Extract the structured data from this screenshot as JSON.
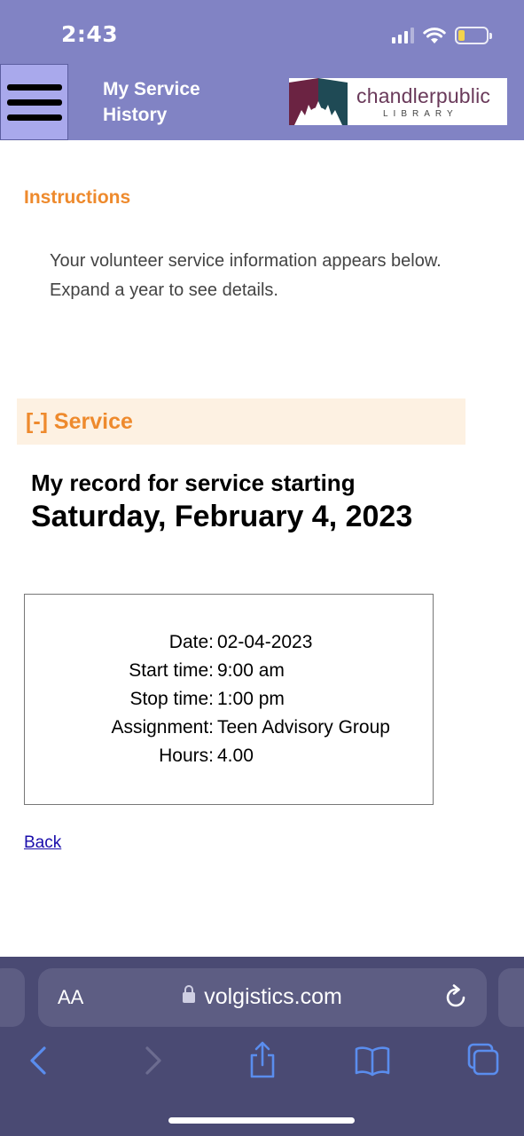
{
  "status_bar": {
    "time": "2:43",
    "icons": [
      "signal-icon",
      "wifi-icon",
      "battery-icon"
    ],
    "battery_color": "#f4d34b"
  },
  "header": {
    "menu_icon": "hamburger-menu-icon",
    "title": "My Service History",
    "logo": {
      "name": "chandlerpublic",
      "sub": "LIBRARY"
    },
    "background": "#8183c4"
  },
  "instructions": {
    "title": "Instructions",
    "text": "Your volunteer service information appears below. Expand a year to see details."
  },
  "service": {
    "toggle_label": "[-] Service",
    "accent": "#ee8a2d"
  },
  "record": {
    "heading_line1": "My record for service starting",
    "heading_line2": "Saturday, February 4, 2023",
    "rows": [
      {
        "label": "Date:",
        "value": "02-04-2023"
      },
      {
        "label": "Start time:",
        "value": "9:00 am"
      },
      {
        "label": "Stop time:",
        "value": "1:00 pm"
      },
      {
        "label": "Assignment:",
        "value": "Teen Advisory Group"
      },
      {
        "label": "Hours:",
        "value": "4.00"
      }
    ]
  },
  "back_link": "Back",
  "browser": {
    "aa_label": "AA",
    "url": "volgistics.com",
    "toolbar_icons": [
      "back-arrow-icon",
      "forward-arrow-icon",
      "share-icon",
      "bookmarks-icon",
      "tabs-icon"
    ]
  }
}
